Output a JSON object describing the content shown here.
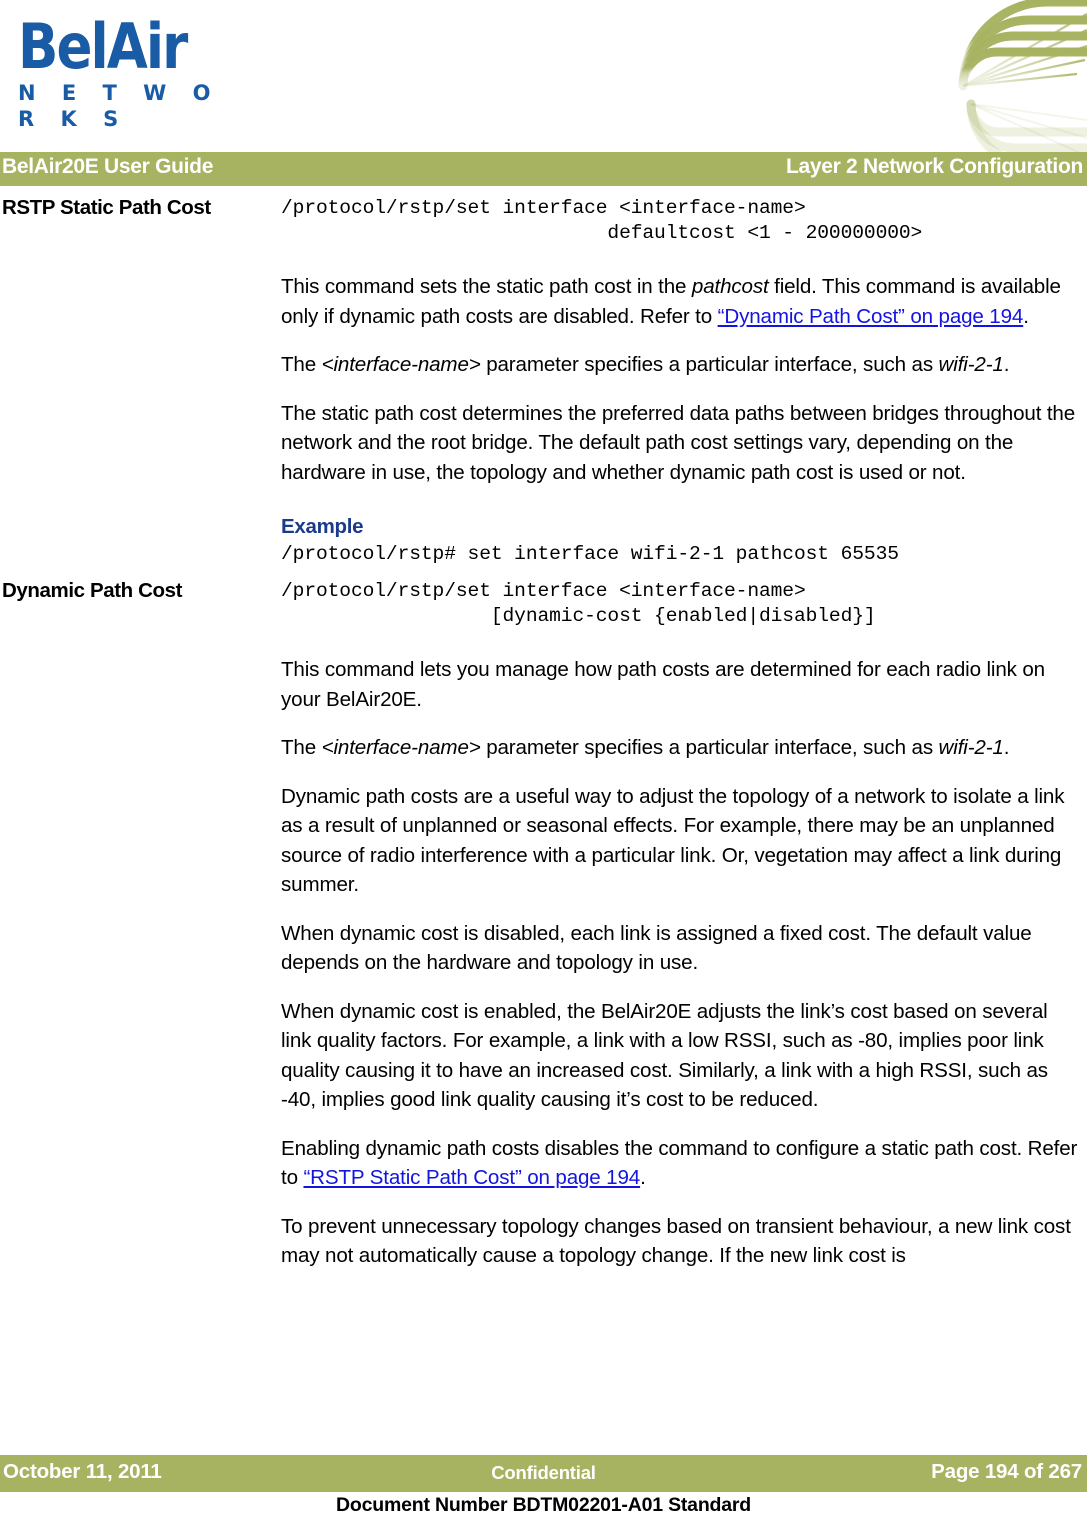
{
  "brand": {
    "logo_primary": "BelAir",
    "logo_secondary": "N E T W O R K S",
    "logo_color": "#1a5ba6",
    "corner_graphic_icon": "radiating-web-arcs",
    "accent_color": "#a8b362"
  },
  "header": {
    "left": "BelAir20E User Guide",
    "right": "Layer 2 Network Configuration"
  },
  "sections": [
    {
      "margin_heading": "RSTP Static Path Cost",
      "syntax_line_1": "/protocol/rstp/set interface <interface-name>",
      "syntax_line_2": "                            defaultcost <1 - 200000000>",
      "paragraphs": [
        {
          "prefix": "This command sets the static path cost in the ",
          "italic": "pathcost",
          "middle": " field. This command is available only if dynamic path costs are disabled. Refer to ",
          "link": "“Dynamic Path Cost” on page 194",
          "suffix": "."
        },
        {
          "prefix": "The ",
          "italic": "<interface-name>",
          "middle": " parameter specifies a particular interface, such as ",
          "italic2": "wifi-2-1",
          "suffix": "."
        },
        {
          "text": "The static path cost determines the preferred data paths between bridges throughout the network and the root bridge. The default path cost settings vary, depending on the hardware in use, the topology and whether dynamic path cost is used or not."
        }
      ],
      "example_heading": "Example",
      "example_code": "/protocol/rstp# set interface wifi-2-1 pathcost 65535"
    },
    {
      "margin_heading": "Dynamic Path Cost",
      "syntax_line_1": "/protocol/rstp/set interface <interface-name>",
      "syntax_line_2": "                  [dynamic-cost {enabled|disabled}]",
      "paragraphs": [
        {
          "text": "This command lets you manage how path costs are determined for each radio link on your BelAir20E."
        },
        {
          "prefix": "The ",
          "italic": "<interface-name>",
          "middle": " parameter specifies a particular interface, such as ",
          "italic2": "wifi-2-1",
          "suffix": "."
        },
        {
          "text": "Dynamic path costs are a useful way to adjust the topology of a network to isolate a link as a result of unplanned or seasonal effects. For example, there may be an unplanned source of radio interference with a particular link. Or, vegetation may affect a link during summer."
        },
        {
          "text": "When dynamic cost is disabled, each link is assigned a fixed cost. The default value depends on the hardware and topology in use."
        },
        {
          "text": "When dynamic cost is enabled, the BelAir20E adjusts the link’s cost based on several link quality factors. For example, a link with a low RSSI, such as -80, implies poor link quality causing it to have an increased cost. Similarly, a link with a high RSSI, such as -40, implies good link quality causing it’s cost to be reduced."
        },
        {
          "prefix": "Enabling dynamic path costs disables the command to configure a static path cost. Refer to ",
          "link": "“RSTP Static Path Cost” on page 194",
          "suffix": "."
        },
        {
          "text": "To prevent unnecessary topology changes based on transient behaviour, a new link cost may not automatically cause a topology change. If the new link cost is"
        }
      ]
    }
  ],
  "footer": {
    "date": "October 11, 2011",
    "classification": "Confidential",
    "page": "Page 194 of 267",
    "document_number": "Document Number BDTM02201-A01 Standard"
  }
}
